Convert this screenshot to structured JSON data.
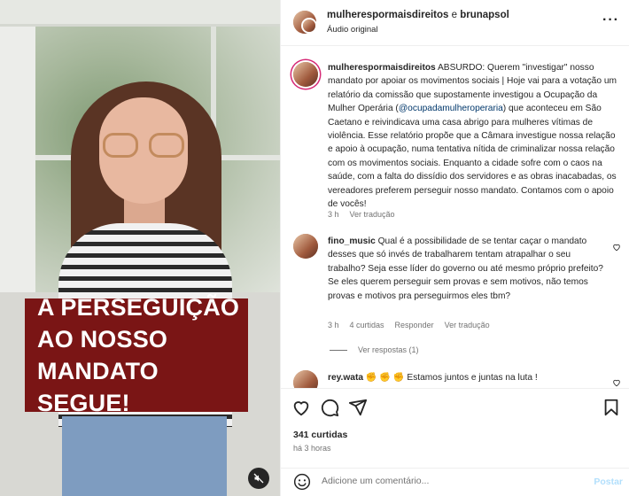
{
  "video": {
    "banner_lines": [
      "A PERSEGUIÇÃO",
      "AO NOSSO",
      "MANDATO SEGUE!"
    ],
    "mute_icon": "speaker-muted-icon"
  },
  "header": {
    "account1": "mulherespormaisdireitos",
    "sep": " e ",
    "account2": "brunapsol",
    "subtitle": "Áudio original",
    "more_icon": "more-horizontal-icon"
  },
  "caption": {
    "username": "mulherespormaisdireitos",
    "text_before": " ABSURDO: Querem \"investigar\" nosso mandato por apoiar os movimentos sociais | Hoje vai para a votação um relatório da comissão que supostamente investigou a Ocupação da Mulher Operária (",
    "mention": "@ocupadamulheroperaria",
    "text_after": ") que aconteceu em São Caetano e reivindicava uma casa abrigo para mulheres vítimas de violência. Esse relatório propõe que a Câmara investigue nossa relação e apoio à ocupação, numa tentativa nítida de criminalizar nossa relação com os movimentos sociais. Enquanto a cidade sofre com o caos na saúde, com a falta do dissídio dos servidores e as obras inacabadas, os vereadores preferem perseguir nosso mandato. Contamos com o apoio de vocês!",
    "time": "3 h",
    "translate": "Ver tradução"
  },
  "comments": [
    {
      "username": "fino_music",
      "text": " Qual é a possibilidade de se tentar caçar o mandato desses que só invés de trabalharem tentam atrapalhar o seu trabalho? Seja esse líder do governo ou até mesmo próprio prefeito? Se eles querem perseguir sem provas e sem motivos, não temos provas e motivos pra perseguirmos eles tbm?",
      "time": "3 h",
      "likes": "4 curtidas",
      "reply": "Responder",
      "translate": "Ver tradução",
      "view_replies": "Ver respostas (1)"
    },
    {
      "username": "rey.wata",
      "text": " ✊ ✊ ✊ Estamos juntos e juntas na luta !"
    }
  ],
  "actions": {
    "like_icon": "heart-icon",
    "comment_icon": "comment-icon",
    "share_icon": "send-icon",
    "save_icon": "bookmark-icon",
    "likes_count": "341 curtidas",
    "posted": "há 3 horas"
  },
  "composer": {
    "emoji_icon": "emoji-icon",
    "placeholder": "Adicione um comentário...",
    "post_label": "Postar"
  },
  "colors": {
    "banner": "#7a1515",
    "link": "#00376b",
    "muted_text": "#737373",
    "post_disabled": "#b2dffc"
  }
}
